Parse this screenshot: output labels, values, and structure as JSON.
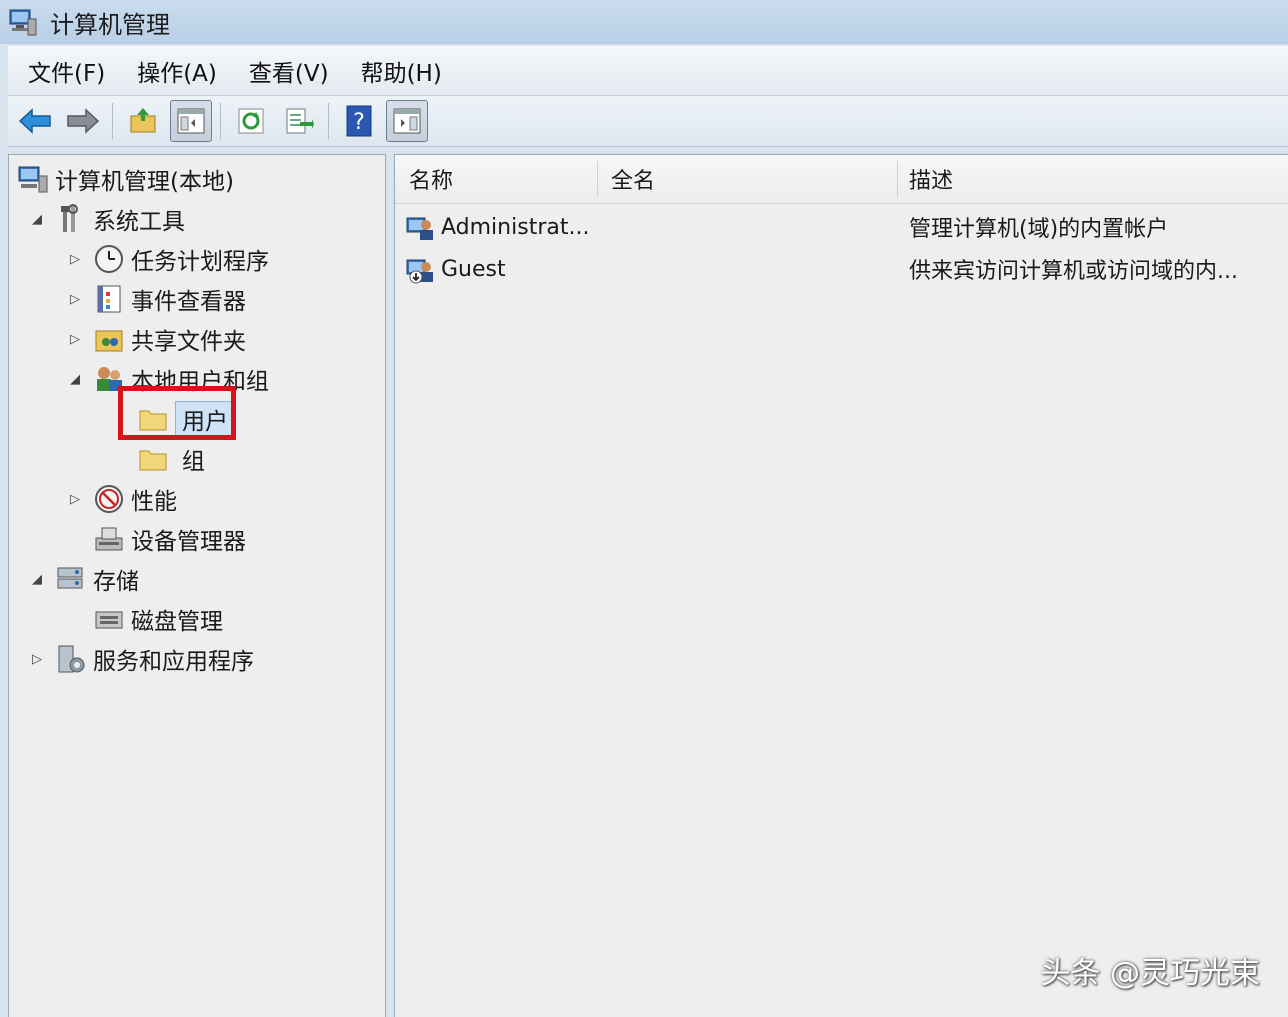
{
  "window": {
    "title": "计算机管理"
  },
  "menu": [
    "文件(F)",
    "操作(A)",
    "查看(V)",
    "帮助(H)"
  ],
  "toolbar": {
    "buttons": [
      "back-icon",
      "forward-icon",
      "up-folder-icon",
      "show-console-tree-icon",
      "refresh-icon",
      "export-list-icon",
      "help-icon",
      "action-pane-icon"
    ]
  },
  "tree": {
    "root": "计算机管理(本地)",
    "system_tools": "系统工具",
    "task_scheduler": "任务计划程序",
    "event_viewer": "事件查看器",
    "shared_folders": "共享文件夹",
    "local_users_groups": "本地用户和组",
    "users": "用户",
    "groups": "组",
    "performance": "性能",
    "device_manager": "设备管理器",
    "storage": "存储",
    "disk_management": "磁盘管理",
    "services_apps": "服务和应用程序"
  },
  "list": {
    "columns": [
      "名称",
      "全名",
      "描述"
    ],
    "rows": [
      {
        "name": "Administrat...",
        "full_name": "",
        "description": "管理计算机(域)的内置帐户"
      },
      {
        "name": "Guest",
        "full_name": "",
        "description": "供来宾访问计算机或访问域的内..."
      }
    ]
  },
  "watermark": "头条 @灵巧光束",
  "colors": {
    "highlight_box": "#d8121a",
    "selection": "#cfe3f7",
    "title_bar": "#c9dcef"
  }
}
